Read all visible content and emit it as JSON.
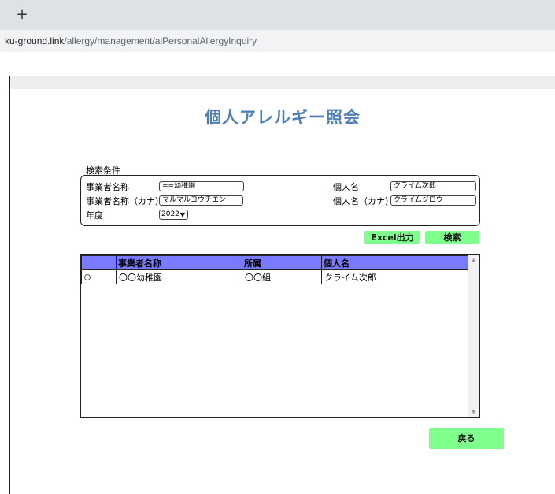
{
  "browser": {
    "new_tab_glyph": "+",
    "url_host": "ku-ground.link",
    "url_path": "/allergy/management/alPersonalAllergyInquiry"
  },
  "page": {
    "title": "個人アレルギー照会"
  },
  "search": {
    "section_label": "検索条件",
    "company_name_label": "事業者名称",
    "company_name_value": "==幼稚園",
    "company_kana_label": "事業者名称（カナ）",
    "company_kana_value": "マルマルヨウチエン",
    "year_label": "年度",
    "year_value": "2022",
    "person_name_label": "個人名",
    "person_name_value": "クライム次郎",
    "person_kana_label": "個人名（カナ）",
    "person_kana_value": "クライムジロウ"
  },
  "actions": {
    "excel_label": "Excel出力",
    "search_label": "検索",
    "back_label": "戻る"
  },
  "table": {
    "headers": [
      "",
      "事業者名称",
      "所属",
      "個人名"
    ],
    "rows": [
      {
        "company": "〇〇幼稚園",
        "dept": "〇〇組",
        "name": "クライム次郎"
      }
    ]
  },
  "colors": {
    "title": "#4e7fb8",
    "button": "#7fff8c",
    "header": "#7a7aff"
  }
}
